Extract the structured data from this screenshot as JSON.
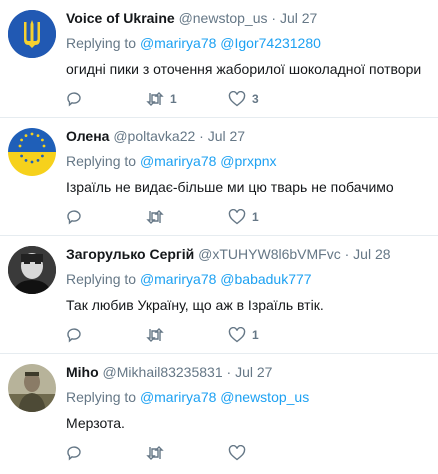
{
  "tweets": [
    {
      "name": "Voice of Ukraine",
      "handle": "@newstop_us",
      "dot": "·",
      "date": "Jul 27",
      "replying_label": "Replying to",
      "mention1": "@marirya78",
      "mention2": "@Igor74231280",
      "text": "огидні пики з оточення жаборилої шоколадної потвори",
      "retweets": "1",
      "likes": "3",
      "avatar": "ukraine-trident-icon"
    },
    {
      "name": "Олена",
      "handle": "@poltavka22",
      "dot": "·",
      "date": "Jul 27",
      "replying_label": "Replying to",
      "mention1": "@marirya78",
      "mention2": "@prxpnx",
      "text": "Ізраїль не видає-більше ми цю тварь не побачимо",
      "retweets": "",
      "likes": "1",
      "avatar": "eu-ukraine-flag-icon"
    },
    {
      "name": "Загорулько Сергій",
      "handle": "@xTUHYW8l6bVMFvc",
      "dot": "·",
      "date": "Jul 28",
      "replying_label": "Replying to",
      "mention1": "@marirya78",
      "mention2": "@babaduk777",
      "text": "Так любив Україну, що аж в Ізраїль втік.",
      "retweets": "",
      "likes": "1",
      "avatar": "portrait-photo"
    },
    {
      "name": "Miho",
      "handle": "@Mikhail83235831",
      "dot": "·",
      "date": "Jul 27",
      "replying_label": "Replying to",
      "mention1": "@marirya78",
      "mention2": "@newstop_us",
      "text": "Мерзота.",
      "retweets": "",
      "likes": "",
      "avatar": "soldier-photo"
    }
  ],
  "colors": {
    "link": "#1da1f2",
    "muted": "#657786",
    "divider": "#e6ecf0"
  }
}
